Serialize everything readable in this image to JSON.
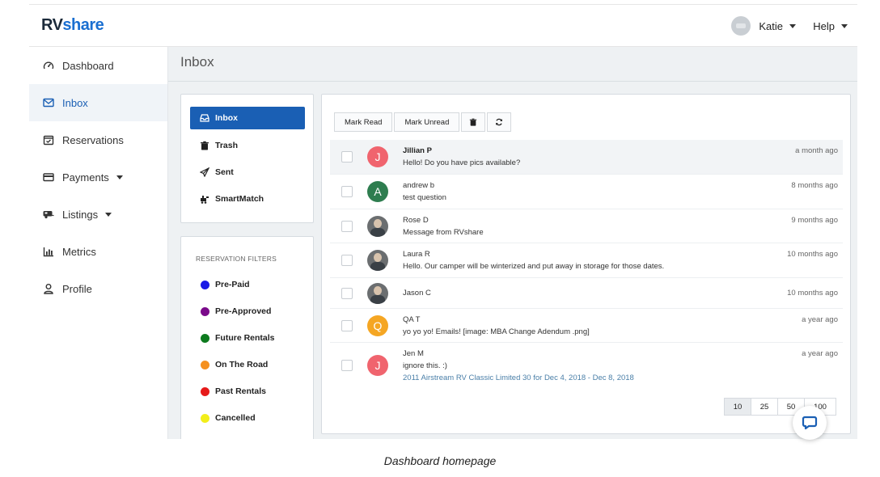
{
  "header": {
    "logo_part1": "RV",
    "logo_part2": "share",
    "user_name": "Katie",
    "help_label": "Help"
  },
  "sidebar": {
    "items": [
      {
        "label": "Dashboard",
        "icon": "dashboard-gauge-icon"
      },
      {
        "label": "Inbox",
        "icon": "envelope-icon",
        "active": true
      },
      {
        "label": "Reservations",
        "icon": "calendar-check-icon"
      },
      {
        "label": "Payments",
        "icon": "credit-card-icon",
        "dropdown": true
      },
      {
        "label": "Listings",
        "icon": "rv-trailer-icon",
        "dropdown": true
      },
      {
        "label": "Metrics",
        "icon": "bar-chart-icon"
      },
      {
        "label": "Profile",
        "icon": "user-icon"
      }
    ]
  },
  "main": {
    "page_title": "Inbox",
    "folders": [
      {
        "label": "Inbox",
        "icon": "inbox-tray-icon",
        "active": true
      },
      {
        "label": "Trash",
        "icon": "trash-icon"
      },
      {
        "label": "Sent",
        "icon": "paper-plane-icon"
      },
      {
        "label": "SmartMatch",
        "icon": "smartmatch-icon"
      }
    ],
    "filters_title": "RESERVATION FILTERS",
    "filters": [
      {
        "label": "Pre-Paid",
        "color": "#1a1ae6"
      },
      {
        "label": "Pre-Approved",
        "color": "#7a0a8a"
      },
      {
        "label": "Future Rentals",
        "color": "#0d7a1e"
      },
      {
        "label": "On The Road",
        "color": "#f5901e"
      },
      {
        "label": "Past Rentals",
        "color": "#e61a1a"
      },
      {
        "label": "Cancelled",
        "color": "#f2ee1a"
      }
    ],
    "toolbar": {
      "mark_read": "Mark Read",
      "mark_unread": "Mark Unread",
      "delete_icon": "trash-icon",
      "refresh_icon": "refresh-icon"
    },
    "messages": [
      {
        "name": "Jillian P",
        "preview": "Hello! Do you have pics available?",
        "time": "a month ago",
        "avatar_letter": "J",
        "avatar_color": "#f0646e",
        "unread": true
      },
      {
        "name": "andrew b",
        "preview": "test question",
        "time": "8 months ago",
        "avatar_letter": "A",
        "avatar_color": "#2e7d4f"
      },
      {
        "name": "Rose D",
        "preview": "Message from RVshare",
        "time": "9 months ago",
        "avatar_letter": "",
        "avatar_color": "#6b6e70"
      },
      {
        "name": "Laura R",
        "preview": "Hello. Our camper will be winterized and put away in storage for those dates.",
        "time": "10 months ago",
        "avatar_letter": "",
        "avatar_color": "#6b6e70"
      },
      {
        "name": "Jason C",
        "preview": "",
        "time": "10 months ago",
        "avatar_letter": "",
        "avatar_color": "#6b6e70"
      },
      {
        "name": "QA T",
        "preview": "yo yo yo! Emails! [image: MBA Change Adendum .png]",
        "time": "a year ago",
        "avatar_letter": "Q",
        "avatar_color": "#f5a623"
      },
      {
        "name": "Jen M",
        "preview": "ignore this. :)",
        "subline": "2011 Airstream RV Classic Limited 30 for Dec 4, 2018 - Dec 8, 2018",
        "time": "a year ago",
        "avatar_letter": "J",
        "avatar_color": "#f0646e"
      }
    ],
    "page_sizes": [
      "10",
      "25",
      "50",
      "100"
    ],
    "page_size_selected": "10"
  },
  "chat": {
    "icon": "chat-bubble-icon",
    "color": "#1a5fb4"
  },
  "caption": "Dashboard homepage"
}
